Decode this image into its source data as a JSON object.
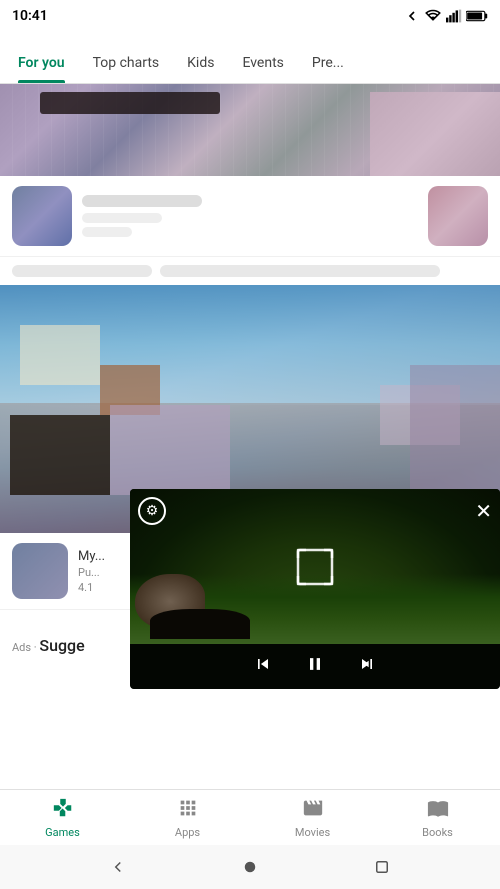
{
  "statusBar": {
    "time": "10:41",
    "batteryLevel": 85
  },
  "navTabs": {
    "items": [
      {
        "id": "for-you",
        "label": "For you",
        "active": true
      },
      {
        "id": "top-charts",
        "label": "Top charts",
        "active": false
      },
      {
        "id": "kids",
        "label": "Kids",
        "active": false
      },
      {
        "id": "events",
        "label": "Events",
        "active": false
      },
      {
        "id": "premium",
        "label": "Pre...",
        "active": false
      }
    ]
  },
  "adsRow": {
    "prefix": "Ads · ",
    "title": "Sugge"
  },
  "appItem": {
    "title": "My...",
    "publisher": "Pu...",
    "rating": "4.1"
  },
  "videoPlayer": {
    "settings_label": "Settings",
    "close_label": "Close",
    "fullscreen_label": "Fullscreen",
    "prev_label": "Previous",
    "pause_label": "Pause",
    "next_label": "Next"
  },
  "bottomNav": {
    "items": [
      {
        "id": "games",
        "label": "Games",
        "icon": "🎮",
        "active": true
      },
      {
        "id": "apps",
        "label": "Apps",
        "icon": "⊞",
        "active": false
      },
      {
        "id": "movies",
        "label": "Movies",
        "icon": "🎬",
        "active": false
      },
      {
        "id": "books",
        "label": "Books",
        "icon": "📚",
        "active": false
      }
    ]
  },
  "systemNav": {
    "back_label": "Back",
    "home_label": "Home",
    "recents_label": "Recents"
  },
  "colors": {
    "accent": "#01875f",
    "tabUnderline": "#01875f"
  }
}
